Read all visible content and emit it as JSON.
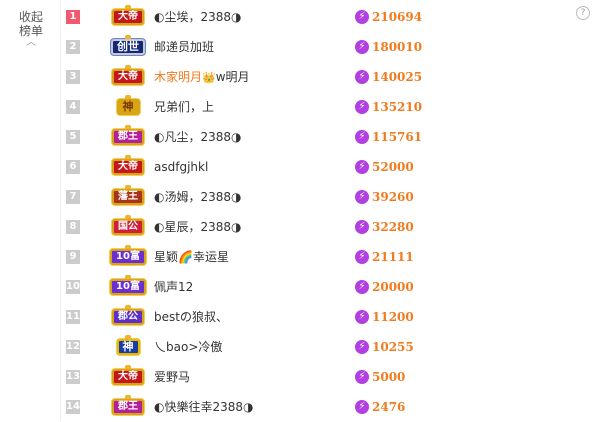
{
  "sidebar": {
    "collapse_label": "收起榜单",
    "chevron_icon": "chevron-up-icon"
  },
  "help": {
    "label": "?"
  },
  "leaderboard": [
    {
      "rank": "1",
      "badge": "大帝",
      "badge_type": "dadi",
      "name": "◐尘埃，2388◑",
      "score": "210694",
      "name_color": "default"
    },
    {
      "rank": "2",
      "badge": "创世",
      "badge_type": "chuangshi",
      "name": "邮递员加班",
      "score": "180010",
      "name_color": "default"
    },
    {
      "rank": "3",
      "badge": "大帝",
      "badge_type": "dadi",
      "name": "木家明月",
      "name_suffix": "w明月",
      "score": "140025",
      "name_color": "orange"
    },
    {
      "rank": "4",
      "badge": "神",
      "badge_type": "shen",
      "name": "兄弟们，上",
      "score": "135210",
      "name_color": "default"
    },
    {
      "rank": "5",
      "badge": "郡王",
      "badge_type": "junwang",
      "name": "◐凡尘，2388◑",
      "score": "115761",
      "name_color": "default"
    },
    {
      "rank": "6",
      "badge": "大帝",
      "badge_type": "dadi",
      "name": "asdfgjhkl",
      "score": "52000",
      "name_color": "default"
    },
    {
      "rank": "7",
      "badge": "藩王",
      "badge_type": "fanwang",
      "name": "◐汤姆，2388◑",
      "score": "39260",
      "name_color": "default"
    },
    {
      "rank": "8",
      "badge": "国公",
      "badge_type": "guogong",
      "name": "◐星辰，2388◑",
      "score": "32280",
      "name_color": "default"
    },
    {
      "rank": "9",
      "badge": "10富",
      "badge_type": "shifu",
      "name": "星颖🌈幸运星",
      "score": "21111",
      "name_color": "default"
    },
    {
      "rank": "10",
      "badge": "10富",
      "badge_type": "shifu",
      "name": "佩声12",
      "score": "20000",
      "name_color": "default"
    },
    {
      "rank": "11",
      "badge": "郡公",
      "badge_type": "jungong",
      "name": "bestの狼叔、",
      "score": "11200",
      "name_color": "default"
    },
    {
      "rank": "12",
      "badge": "神",
      "badge_type": "shen2",
      "name": "乀bao>冷傲",
      "score": "10255",
      "name_color": "default"
    },
    {
      "rank": "13",
      "badge": "大帝",
      "badge_type": "dadi",
      "name": "爱野马",
      "score": "5000",
      "name_color": "default"
    },
    {
      "rank": "14",
      "badge": "郡王",
      "badge_type": "junwang",
      "name": "◐快樂往幸2388◑",
      "score": "2476",
      "name_color": "default"
    }
  ],
  "icons": {
    "score": "lightning-gem-icon",
    "badge_crown": "crown-icon"
  },
  "colors": {
    "rank_top": "#f2596f",
    "rank_other": "#cccccc",
    "score": "#f07b1e",
    "highlight_name": "#ee7a1c"
  }
}
